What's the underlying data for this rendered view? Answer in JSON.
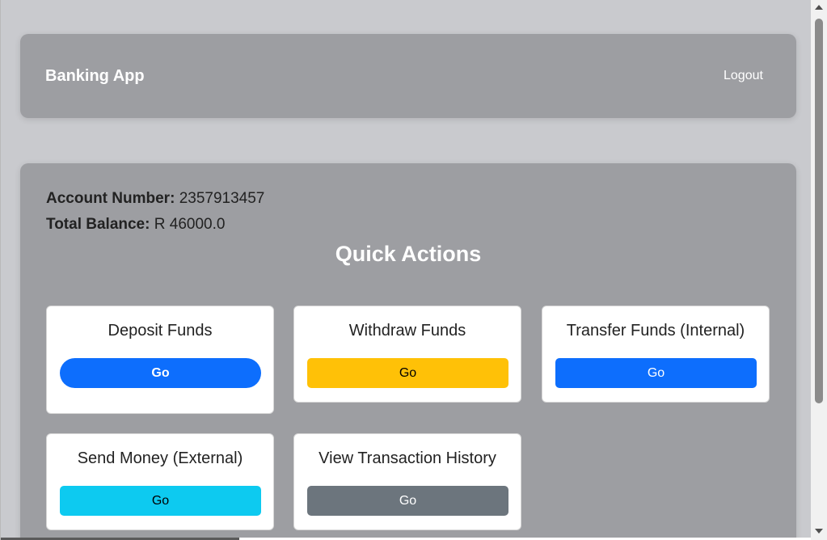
{
  "app": {
    "brand": "Banking App",
    "logout_label": "Logout"
  },
  "account": {
    "number_label": "Account Number:",
    "number_value": "2357913457",
    "balance_label": "Total Balance:",
    "balance_value": "R 46000.0"
  },
  "quick_actions": {
    "title": "Quick Actions",
    "cards": [
      {
        "title": "Deposit Funds",
        "button_label": "Go",
        "button_color": "#0d6efd",
        "button_text_color": "#ffffff"
      },
      {
        "title": "Withdraw Funds",
        "button_label": "Go",
        "button_color": "#ffc107",
        "button_text_color": "#000000"
      },
      {
        "title": "Transfer Funds (Internal)",
        "button_label": "Go",
        "button_color": "#0d6efd",
        "button_text_color": "#ffffff"
      },
      {
        "title": "Send Money (External)",
        "button_label": "Go",
        "button_color": "#0dcaf0",
        "button_text_color": "#000000"
      },
      {
        "title": "View Transaction History",
        "button_label": "Go",
        "button_color": "#6c757d",
        "button_text_color": "#ffffff"
      }
    ]
  },
  "colors": {
    "page_background": "#c9cace",
    "panel_background": "#9d9ea2",
    "card_background": "#ffffff"
  }
}
